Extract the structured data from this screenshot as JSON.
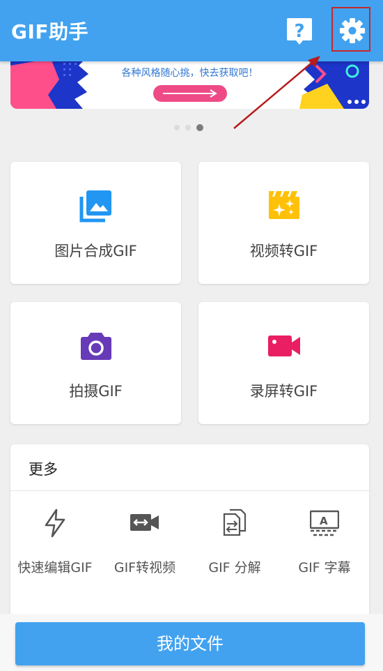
{
  "app_bar": {
    "title": "GIF助手",
    "accent": "#42a2ef"
  },
  "banner": {
    "text": "各种风格随心挑，快去获取吧！",
    "page_count": 3,
    "active_page": 3
  },
  "features": [
    {
      "label": "图片合成GIF",
      "icon": "image-gallery-icon",
      "color": "#2196f3"
    },
    {
      "label": "视频转GIF",
      "icon": "video-clapper-icon",
      "color": "#ffc107"
    },
    {
      "label": "拍摄GIF",
      "icon": "camera-icon",
      "color": "#673ab7"
    },
    {
      "label": "录屏转GIF",
      "icon": "video-camera-icon",
      "color": "#e91e63"
    }
  ],
  "more": {
    "title": "更多",
    "tools": [
      {
        "label": "快速编辑GIF",
        "icon": "flash-icon"
      },
      {
        "label": "GIF转视频",
        "icon": "convert-video-icon"
      },
      {
        "label": "GIF 分解",
        "icon": "split-icon"
      },
      {
        "label": "GIF 字幕",
        "icon": "subtitle-icon"
      }
    ]
  },
  "bottom": {
    "files_label": "我的文件"
  }
}
